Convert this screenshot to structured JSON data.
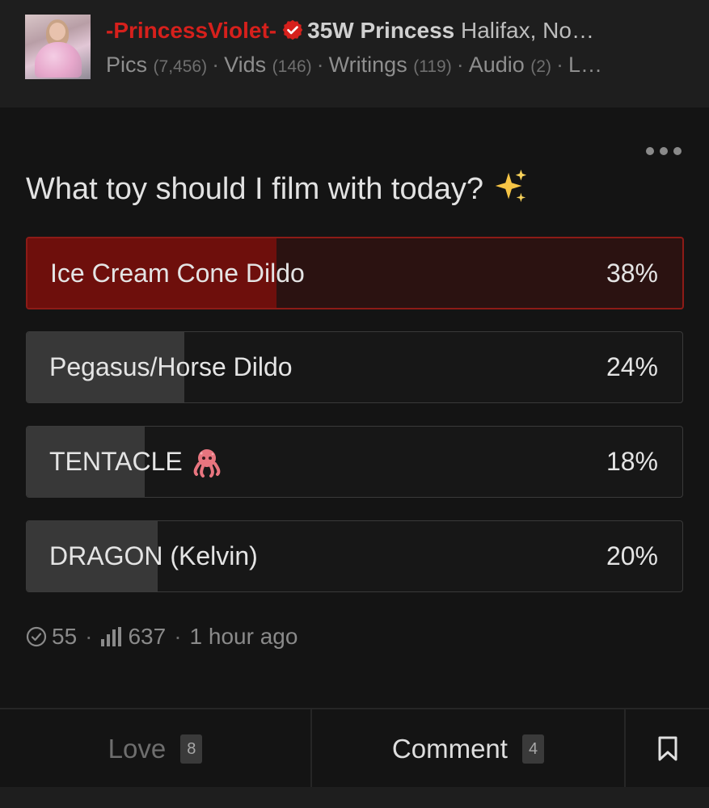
{
  "header": {
    "username": "-PrincessViolet-",
    "rank": "35W Princess",
    "location": "Halifax, No…",
    "media": [
      {
        "label": "Pics",
        "count": "(7,456)"
      },
      {
        "label": "Vids",
        "count": "(146)"
      },
      {
        "label": "Writings",
        "count": "(119)"
      },
      {
        "label": "Audio",
        "count": "(2)"
      },
      {
        "label": "L…",
        "count": ""
      }
    ],
    "separator": "·"
  },
  "poll": {
    "question": "What toy should I film with today?",
    "options": [
      {
        "label": "Ice Cream Cone Dildo",
        "percent": "38%",
        "fraction": 0.38,
        "selected": true
      },
      {
        "label": "Pegasus/Horse Dildo",
        "percent": "24%",
        "fraction": 0.24,
        "selected": false
      },
      {
        "label": "TENTACLE",
        "percent": "18%",
        "fraction": 0.18,
        "selected": false
      },
      {
        "label": "DRAGON (Kelvin)",
        "percent": "20%",
        "fraction": 0.2,
        "selected": false
      }
    ]
  },
  "stats": {
    "votes": "55",
    "views": "637",
    "time": "1 hour ago",
    "separator": "·"
  },
  "footer": {
    "love_label": "Love",
    "love_count": "8",
    "comment_label": "Comment",
    "comment_count": "4"
  },
  "colors": {
    "brand": "#d6201c",
    "selected_fill": "#6e0f0c",
    "bar_fill": "#383838",
    "background": "#141414"
  }
}
